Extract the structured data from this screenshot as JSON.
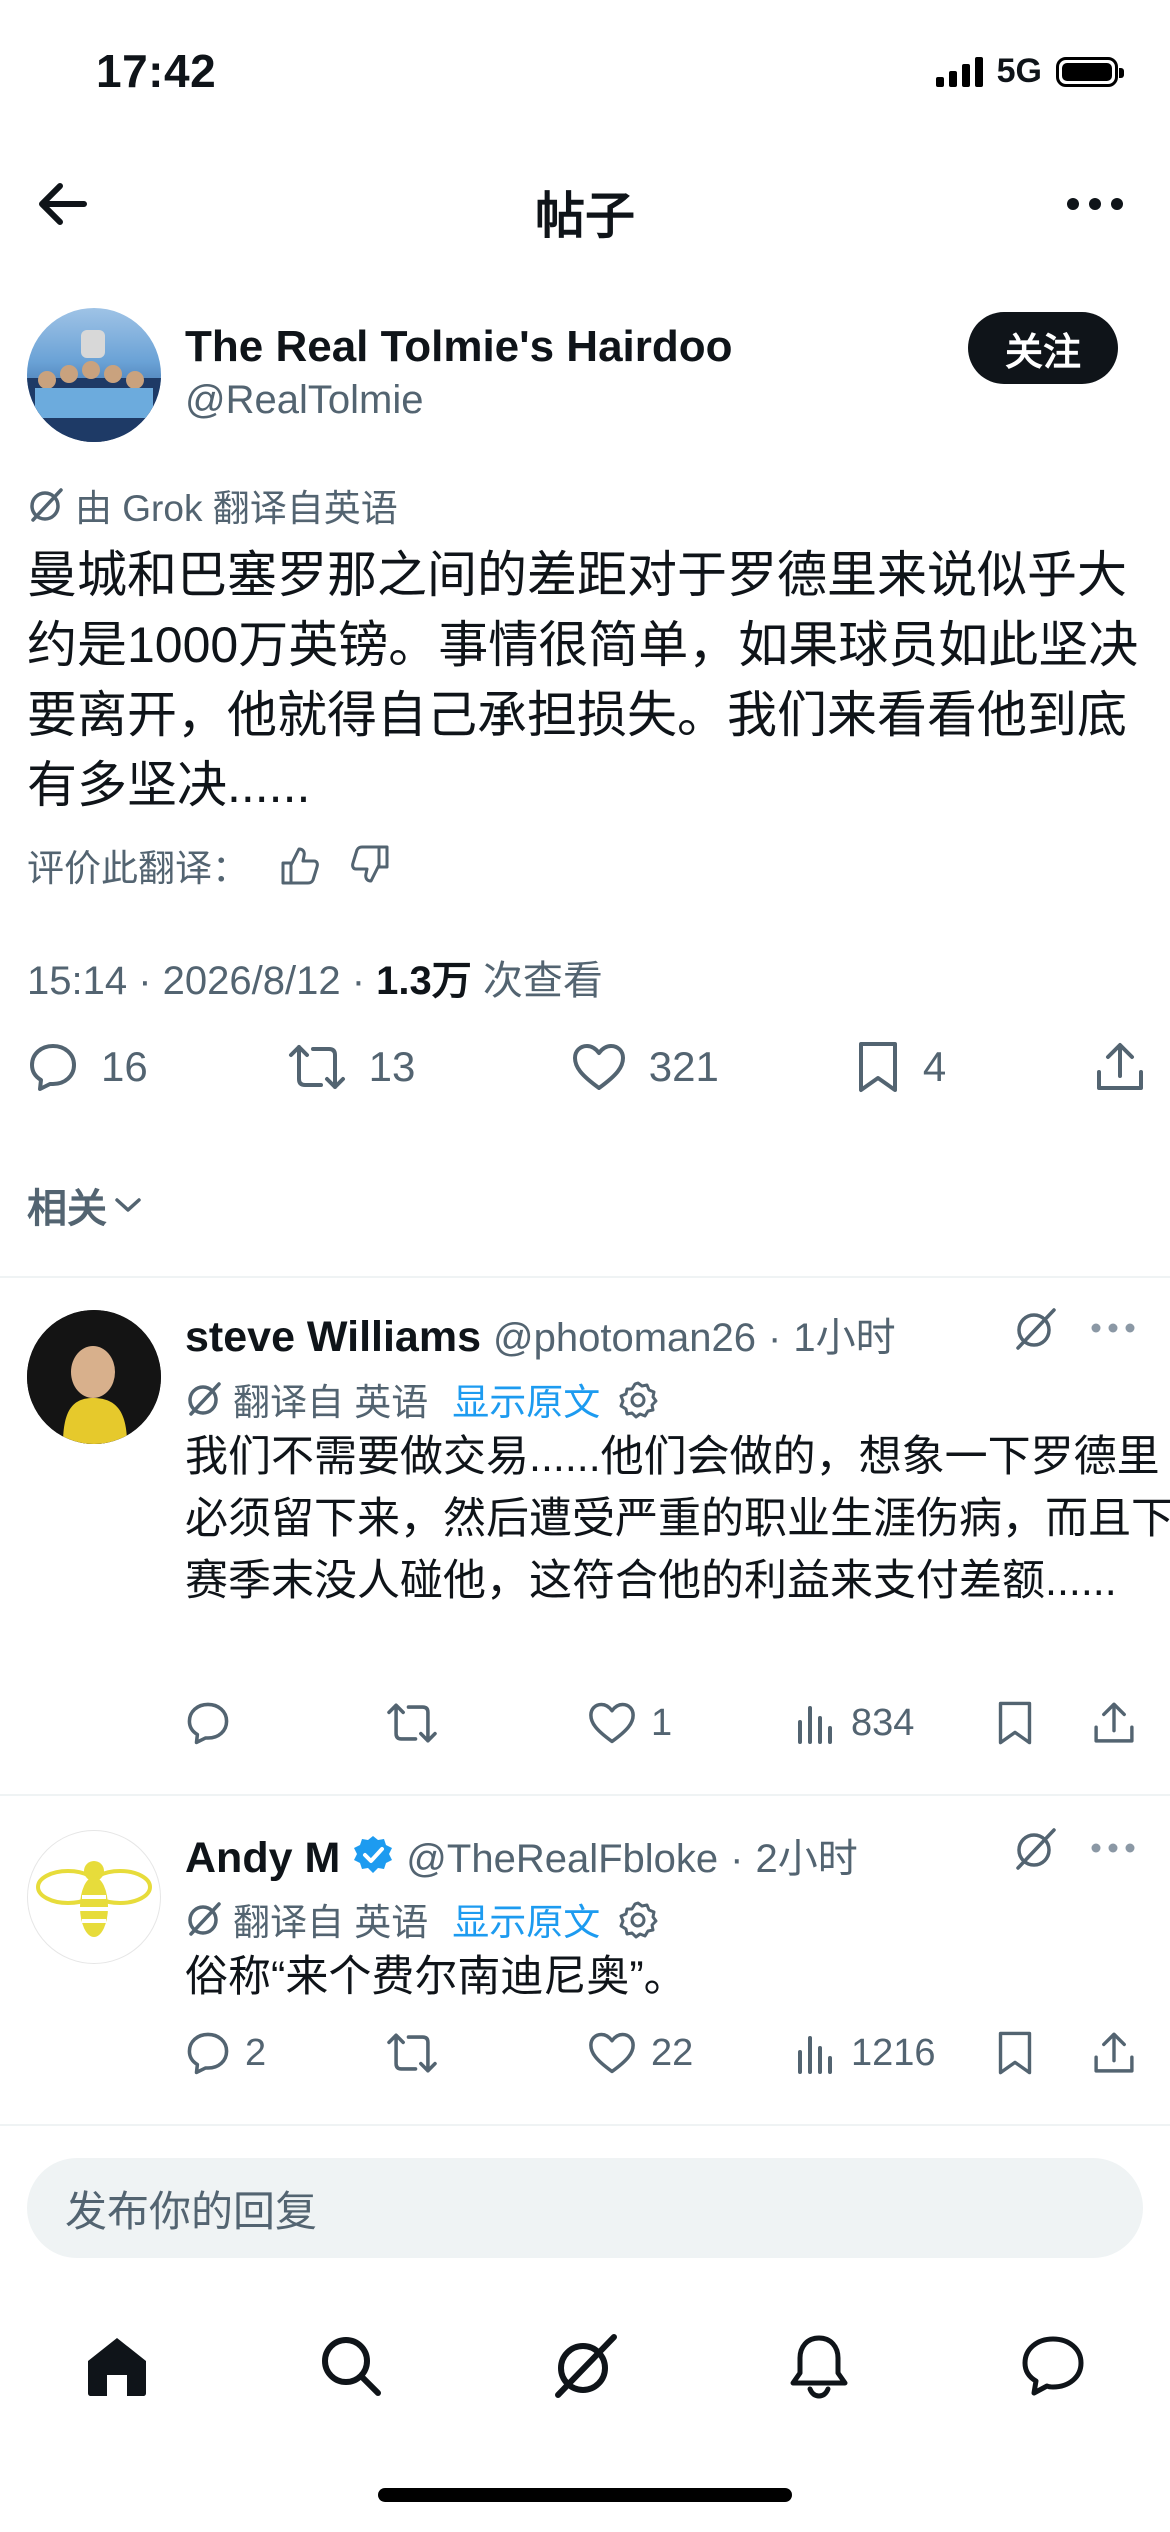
{
  "status_bar": {
    "time": "17:42",
    "network": "5G"
  },
  "header": {
    "title": "帖子"
  },
  "post": {
    "author_name": "The Real Tolmie's Hairdoo",
    "author_handle": "@RealTolmie",
    "follow_label": "关注",
    "translation_note": "由 Grok 翻译自英语",
    "text": "曼城和巴塞罗那之间的差距对于罗德里来说似乎大约是1000万英镑。事情很简单，如果球员如此坚决要离开，他就得自己承担损失。我们来看看他到底有多坚决......",
    "rate_translation_label": "评价此翻译：",
    "timestamp": "15:14 · 2026/8/12 · ",
    "views": "1.3万",
    "views_label": " 次查看",
    "stats": {
      "replies": "16",
      "retweets": "13",
      "likes": "321",
      "bookmarks": "4"
    }
  },
  "related_label": "相关",
  "replies": [
    {
      "name": "steve  Williams",
      "handle": "@photoman26",
      "time": "1小时",
      "translation_note": "翻译自 英语",
      "show_original": "显示原文",
      "text": "我们不需要做交易......他们会做的，想象一下罗德里必须留下来，然后遭受严重的职业生涯伤病，而且下赛季末没人碰他，这符合他的利益来支付差额......",
      "stats": {
        "replies": "",
        "retweets": "",
        "likes": "1",
        "views": "834"
      }
    },
    {
      "name": "Andy M",
      "handle": "@TheRealFbloke",
      "time": "2小时",
      "verified": true,
      "translation_note": "翻译自 英语",
      "show_original": "显示原文",
      "text": "俗称“来个费尔南迪尼奥”。",
      "stats": {
        "replies": "2",
        "retweets": "",
        "likes": "22",
        "views": "1216"
      }
    }
  ],
  "composer": {
    "placeholder": "发布你的回复"
  },
  "icons": {
    "back": "arrow-left-icon",
    "more": "more-horizontal-icon",
    "grok": "grok-icon",
    "reply": "reply-icon",
    "retweet": "retweet-icon",
    "like": "heart-icon",
    "bookmark": "bookmark-icon",
    "share": "share-icon",
    "views": "views-chart-icon",
    "settings": "gear-icon",
    "verified": "verified-badge-icon",
    "tabs": [
      "home-icon",
      "search-icon",
      "grok-icon",
      "bell-icon",
      "messages-icon"
    ]
  },
  "colors": {
    "accent": "#1d9bf0",
    "text": "#0f1419",
    "secondary": "#536471",
    "button": "#0f1419"
  }
}
